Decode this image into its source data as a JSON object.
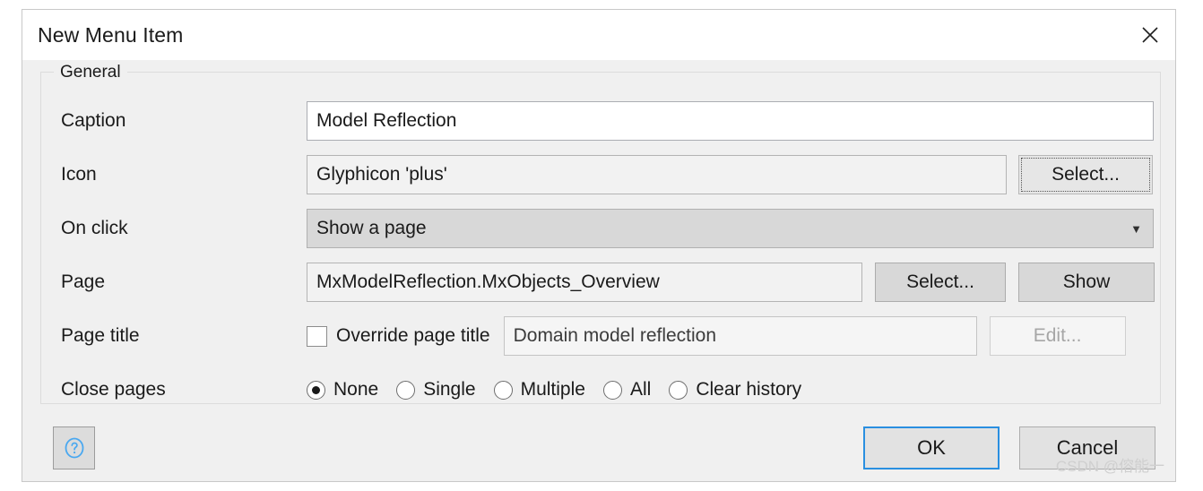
{
  "dialog": {
    "title": "New Menu Item",
    "close_icon": "close-icon"
  },
  "group": {
    "legend": "General"
  },
  "fields": {
    "caption": {
      "label": "Caption",
      "value": "Model Reflection"
    },
    "icon": {
      "label": "Icon",
      "value": "Glyphicon 'plus'",
      "select_button": "Select..."
    },
    "on_click": {
      "label": "On click",
      "value": "Show a page",
      "arrow_icon": "chevron-down-icon"
    },
    "page": {
      "label": "Page",
      "value": "MxModelReflection.MxObjects_Overview",
      "select_button": "Select...",
      "show_button": "Show"
    },
    "page_title": {
      "label": "Page title",
      "override_label": "Override page title",
      "override_checked": false,
      "value": "Domain model reflection",
      "edit_button": "Edit..."
    },
    "close_pages": {
      "label": "Close pages",
      "options": [
        {
          "label": "None",
          "selected": true
        },
        {
          "label": "Single",
          "selected": false
        },
        {
          "label": "Multiple",
          "selected": false
        },
        {
          "label": "All",
          "selected": false
        },
        {
          "label": "Clear history",
          "selected": false
        }
      ]
    }
  },
  "footer": {
    "help_icon": "help-circle-icon",
    "ok_label": "OK",
    "cancel_label": "Cancel"
  },
  "watermark": "CSDN @傛能一",
  "colors": {
    "accent_blue": "#2a8fe0",
    "dialog_bg": "#f0f0f0",
    "titlebar_bg": "#ffffff"
  }
}
